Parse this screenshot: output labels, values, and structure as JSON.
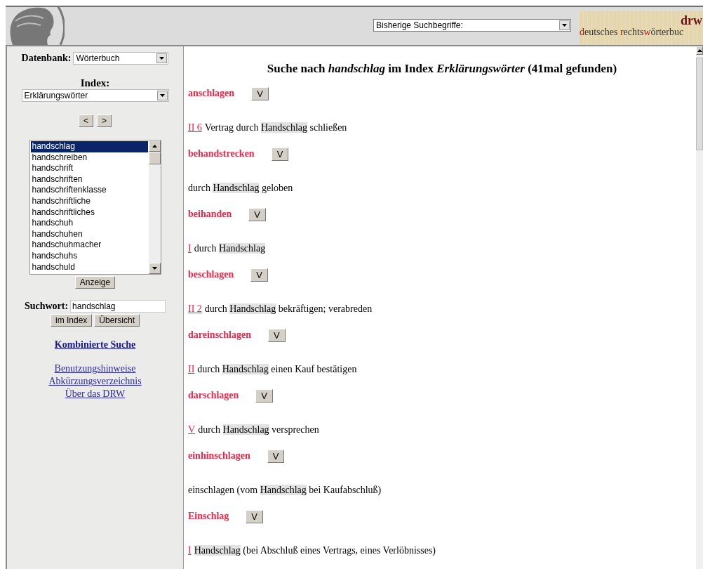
{
  "header": {
    "history_select": {
      "value": "Bisherige Suchbegriffe:"
    },
    "logo": {
      "mark": "drw",
      "tagline": [
        {
          "text": "d",
          "accent": true
        },
        {
          "text": "eutsches ",
          "accent": false
        },
        {
          "text": "r",
          "accent": true
        },
        {
          "text": "echts",
          "accent": false
        },
        {
          "text": "w",
          "accent": true
        },
        {
          "text": "örterbuc",
          "accent": false
        }
      ]
    }
  },
  "sidebar": {
    "database": {
      "label": "Datenbank:",
      "value": "Wörterbuch"
    },
    "index": {
      "label": "Index:",
      "value": "Erklärungswörter"
    },
    "nav_buttons": [
      "<",
      ">"
    ],
    "word_list": [
      {
        "label": "handschlag",
        "selected": true
      },
      {
        "label": "handschreiben",
        "selected": false
      },
      {
        "label": "handschrift",
        "selected": false
      },
      {
        "label": "handschriften",
        "selected": false
      },
      {
        "label": "handschriftenklasse",
        "selected": false
      },
      {
        "label": "handschriftliche",
        "selected": false
      },
      {
        "label": "handschriftliches",
        "selected": false
      },
      {
        "label": "handschuh",
        "selected": false
      },
      {
        "label": "handschuhen",
        "selected": false
      },
      {
        "label": "handschuhmacher",
        "selected": false
      },
      {
        "label": "handschuhs",
        "selected": false
      },
      {
        "label": "handschuld",
        "selected": false
      }
    ],
    "show_button": "Anzeige",
    "search": {
      "label": "Suchwort:",
      "value": "handschlag"
    },
    "search_buttons": [
      "im Index",
      "Übersicht"
    ],
    "combined_search": "Kombinierte Suche",
    "links": [
      "Benutzungshinweise",
      "Abkürzungsverzeichnis",
      "Über das DRW"
    ]
  },
  "results": {
    "heading": "Suche nach *handschlag* im Index *Erklärungswörter* (41mal gefunden)",
    "entries": [
      {
        "headword": "anschlagen",
        "button": "V",
        "definition": {
          "sense": "II 6",
          "before": "Vertrag durch",
          "match": "Handschlag",
          "after": "schließen"
        }
      },
      {
        "headword": "behandstrecken",
        "button": "V",
        "definition": {
          "before": "durch",
          "match": "Handschlag",
          "after": "geloben"
        }
      },
      {
        "headword": "beihanden",
        "button": "V",
        "definition": {
          "sense": "I",
          "before": "durch",
          "match": "Handschlag"
        }
      },
      {
        "headword": "beschlagen",
        "button": "V",
        "definition": {
          "sense": "II 2",
          "before": "durch",
          "match": "Handschlag",
          "after": "bekräftigen; verabreden"
        }
      },
      {
        "headword": "dareinschlagen",
        "button": "V",
        "definition": {
          "sense": "II",
          "before": "durch",
          "match": "Handschlag",
          "after": "einen Kauf bestätigen"
        }
      },
      {
        "headword": "darschlagen",
        "button": "V",
        "definition": {
          "sense": "V",
          "before": "durch",
          "match": "Handschlag",
          "after": "versprechen"
        }
      },
      {
        "headword": "einhinschlagen",
        "button": "V",
        "definition": {
          "before": "einschlagen (vom",
          "match": "Handschlag",
          "after": "bei Kaufabschluß)"
        }
      },
      {
        "headword": "Einschlag",
        "button": "V",
        "definition": {
          "sense": "I",
          "match": "Handschlag",
          "after": "(bei Abschluß eines Vertrags, eines Verlöbnisses)"
        }
      }
    ]
  }
}
